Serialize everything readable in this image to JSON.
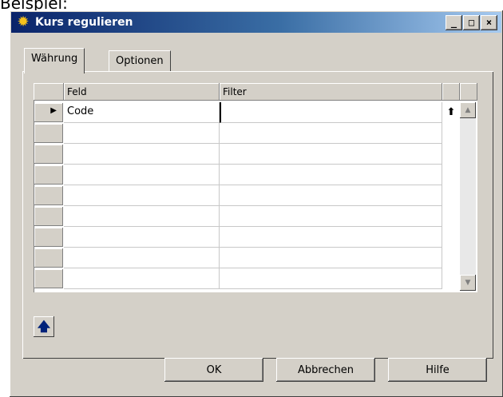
{
  "top_text": "Beispiel:",
  "window": {
    "title": "Kurs regulieren",
    "controls": {
      "minimize": "_",
      "maximize": "□",
      "close": "×"
    }
  },
  "tabs": [
    {
      "label": "Währung",
      "active": true
    },
    {
      "label": "Optionen",
      "active": false
    }
  ],
  "grid": {
    "columns": [
      "Feld",
      "Filter"
    ],
    "rows": [
      {
        "feld": "Code",
        "filter": "",
        "current": true
      },
      {
        "feld": "",
        "filter": ""
      },
      {
        "feld": "",
        "filter": ""
      },
      {
        "feld": "",
        "filter": ""
      },
      {
        "feld": "",
        "filter": ""
      },
      {
        "feld": "",
        "filter": ""
      },
      {
        "feld": "",
        "filter": ""
      },
      {
        "feld": "",
        "filter": ""
      },
      {
        "feld": "",
        "filter": ""
      }
    ],
    "row_indicator": "▶",
    "row_lookup_icon": "up-arrow-icon",
    "scroll_up": "▲",
    "scroll_down": "▼"
  },
  "toolbar": {
    "up_button_icon": "up-arrow-icon",
    "up_symbol": "🡅"
  },
  "buttons": {
    "ok": "OK",
    "cancel": "Abbrechen",
    "help": "Hilfe"
  },
  "colors": {
    "titlebar_start": "#0a246a",
    "titlebar_end": "#a6caf0",
    "face": "#d4d0c8"
  }
}
